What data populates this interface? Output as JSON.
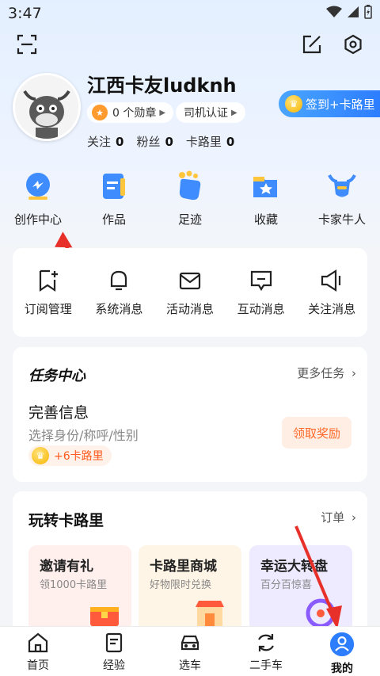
{
  "status_bar": {
    "time": "3:47"
  },
  "profile": {
    "username": "江西卡友ludknh",
    "medals_label": "0 个勋章",
    "driver_cert_label": "司机认证",
    "stats": [
      {
        "label": "关注",
        "value": "0"
      },
      {
        "label": "粉丝",
        "value": "0"
      },
      {
        "label": "卡路里",
        "value": "0"
      }
    ],
    "checkin_label": "签到+卡路里"
  },
  "quick_actions": [
    {
      "label": "创作中心",
      "icon": "creation-center-icon"
    },
    {
      "label": "作品",
      "icon": "works-icon"
    },
    {
      "label": "足迹",
      "icon": "footprint-icon"
    },
    {
      "label": "收藏",
      "icon": "favorites-icon"
    },
    {
      "label": "卡家牛人",
      "icon": "expert-icon"
    }
  ],
  "messages": [
    {
      "label": "订阅管理",
      "icon": "subscribe-icon"
    },
    {
      "label": "系统消息",
      "icon": "bell-icon"
    },
    {
      "label": "活动消息",
      "icon": "mail-icon"
    },
    {
      "label": "互动消息",
      "icon": "chat-icon"
    },
    {
      "label": "关注消息",
      "icon": "megaphone-icon"
    }
  ],
  "task_center": {
    "title": "任务中心",
    "more_label": "更多任务",
    "task_name": "完善信息",
    "task_sub": "选择身份/称呼/性别",
    "reward": "+6卡路里",
    "claim_label": "领取奖励"
  },
  "fun": {
    "title": "玩转卡路里",
    "orders_label": "订单",
    "cards": [
      {
        "title": "邀请有礼",
        "sub": "领1000卡路里",
        "color": "#fff0ee"
      },
      {
        "title": "卡路里商城",
        "sub": "好物限时兑换",
        "color": "#fff5e6"
      },
      {
        "title": "幸运大转盘",
        "sub": "百分百惊喜",
        "color": "#eeeaff"
      }
    ]
  },
  "tabs": [
    {
      "label": "首页"
    },
    {
      "label": "经验"
    },
    {
      "label": "选车"
    },
    {
      "label": "二手车"
    },
    {
      "label": "我的"
    }
  ],
  "colors": {
    "accent": "#2d7dff",
    "orange": "#ff6a2a",
    "arrow": "#e8302a"
  }
}
